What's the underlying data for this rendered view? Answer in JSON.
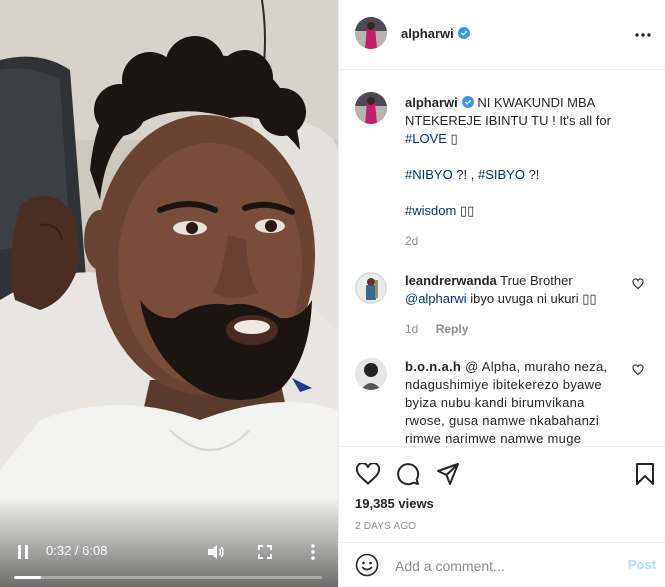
{
  "video": {
    "time": "0:32 / 6:08",
    "progress": 0.087
  },
  "author": {
    "username": "alpharwi",
    "verified": true
  },
  "caption": {
    "username": "alpharwi",
    "line1": "NI KWAKUNDI MBA",
    "line2": "NTEKEREJE IBINTU TU ! It's all for",
    "tag_love": "#LOVE",
    "emoji1": "▯",
    "tag_nibyo": "#NIBYO",
    "sep1": " ?! , ",
    "tag_sibyo": "#SIBYO",
    "sep2": " ?!",
    "tag_wisdom": "#wisdom",
    "emoji2": "▯▯",
    "time": "2d"
  },
  "comments": [
    {
      "username": "leandrerwanda",
      "text_before": "True Brother",
      "mention": "@alpharwi",
      "text_after": "ibyo uvuga ni ukuri ▯▯",
      "time": "1d",
      "reply_label": "Reply"
    },
    {
      "username": "b.o.n.a.h",
      "text": "@ Alpha, muraho neza, ndagushimiye ibitekerezo byawe byiza nubu kandi birumvikana rwose, gusa namwe nkabahanzi rimwe narimwe namwe muge"
    }
  ],
  "actions": {
    "views": "19,385 views",
    "posted": "2 DAYS AGO"
  },
  "add_comment": {
    "placeholder": "Add a comment...",
    "post_label": "Post"
  },
  "colors": {
    "link": "#00376b",
    "verified": "#3897f0",
    "post_disabled": "#b2dffc",
    "meta": "#8e8e8e"
  },
  "icons": [
    "pause-icon",
    "volume-icon",
    "fullscreen-icon",
    "more-vertical-icon",
    "more-horizontal-icon",
    "verified-badge-icon",
    "heart-icon",
    "comment-icon",
    "share-icon",
    "bookmark-icon",
    "emoji-icon"
  ]
}
